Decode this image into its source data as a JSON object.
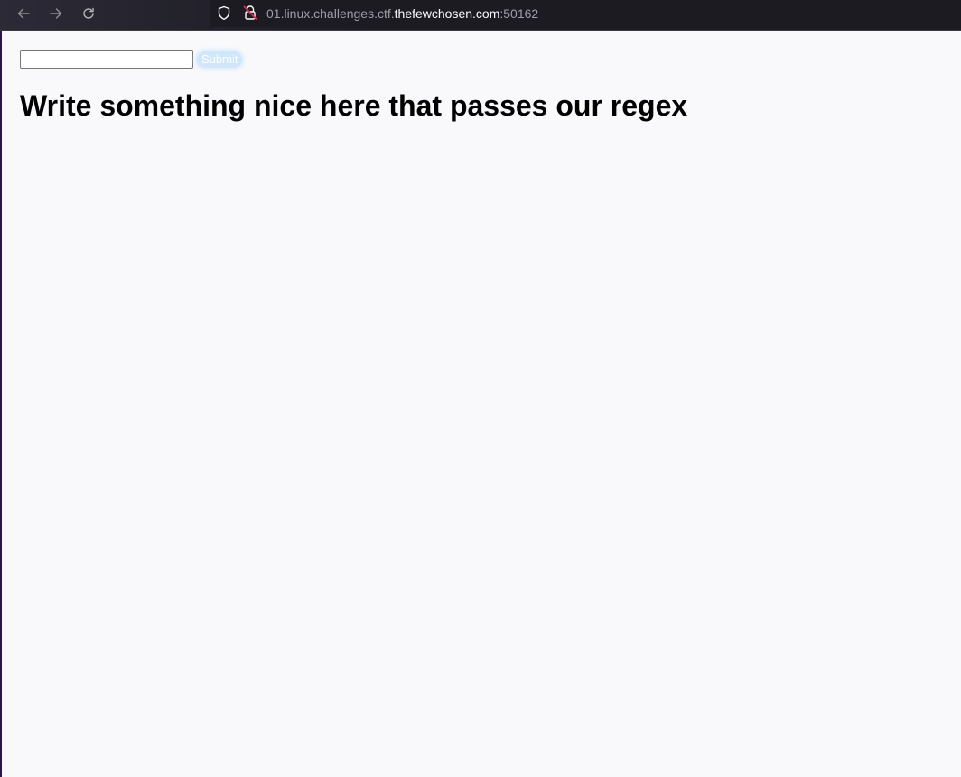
{
  "browser": {
    "url_prefix": "01.linux.challenges.ctf.",
    "url_domain": "thefewchosen.com",
    "url_port": ":50162",
    "icons": {
      "back": "arrow-left-icon",
      "forward": "arrow-right-icon",
      "reload": "reload-icon",
      "tracking": "shield-icon",
      "insecure": "insecure-lock-icon"
    }
  },
  "form": {
    "input_value": "",
    "submit_label": "Submit"
  },
  "page": {
    "heading": "Write something nice here that passes our regex"
  },
  "colors": {
    "page_background": "#f9f9fb",
    "toolbar_background": "#1c1b22",
    "submit_background": "#cfe6fb",
    "insecure_accent": "#e22850"
  }
}
